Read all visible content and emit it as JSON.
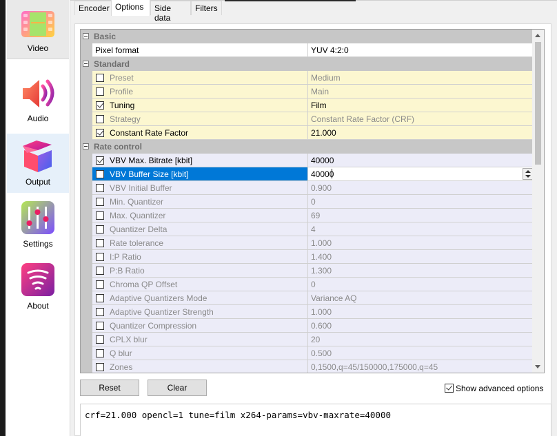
{
  "sidebar": {
    "items": [
      {
        "label": "Video",
        "icon": "video-film-icon"
      },
      {
        "label": "Audio",
        "icon": "speaker-icon"
      },
      {
        "label": "Output",
        "icon": "box-icon"
      },
      {
        "label": "Settings",
        "icon": "sliders-icon"
      },
      {
        "label": "About",
        "icon": "vortex-icon"
      }
    ]
  },
  "tabs": [
    "Encoder",
    "Options",
    "Side data",
    "Filters"
  ],
  "active_tab": "Options",
  "grid": {
    "categories": {
      "basic": "Basic",
      "standard": "Standard",
      "rate_control": "Rate control"
    },
    "pixel_format": {
      "name": "Pixel format",
      "value": "YUV 4:2:0"
    },
    "standard": [
      {
        "name": "Preset",
        "value": "Medium",
        "checked": false
      },
      {
        "name": "Profile",
        "value": "Main",
        "checked": false
      },
      {
        "name": "Tuning",
        "value": "Film",
        "checked": true
      },
      {
        "name": "Strategy",
        "value": "Constant Rate Factor (CRF)",
        "checked": false
      },
      {
        "name": "Constant Rate Factor",
        "value": "21.000",
        "checked": true
      }
    ],
    "rate_control": [
      {
        "name": "VBV Max. Bitrate [kbit]",
        "value": "40000",
        "checked": true
      },
      {
        "name": "VBV Buffer Size [kbit]",
        "value": "40000",
        "checked": false,
        "selected": true
      },
      {
        "name": "VBV Initial Buffer",
        "value": "0.900",
        "checked": false
      },
      {
        "name": "Min. Quantizer",
        "value": "0",
        "checked": false
      },
      {
        "name": "Max. Quantizer",
        "value": "69",
        "checked": false
      },
      {
        "name": "Quantizer Delta",
        "value": "4",
        "checked": false
      },
      {
        "name": "Rate tolerance",
        "value": "1.000",
        "checked": false
      },
      {
        "name": "I:P Ratio",
        "value": "1.400",
        "checked": false
      },
      {
        "name": "P:B Ratio",
        "value": "1.300",
        "checked": false
      },
      {
        "name": "Chroma QP Offset",
        "value": "0",
        "checked": false
      },
      {
        "name": "Adaptive Quantizers Mode",
        "value": "Variance AQ",
        "checked": false
      },
      {
        "name": "Adaptive Quantizer Strength",
        "value": "1.000",
        "checked": false
      },
      {
        "name": "Quantizer Compression",
        "value": "0.600",
        "checked": false
      },
      {
        "name": "CPLX blur",
        "value": "20",
        "checked": false
      },
      {
        "name": "Q blur",
        "value": "0.500",
        "checked": false
      },
      {
        "name": "Zones",
        "value": "0,1500,q=45/150000,175000,q=45",
        "checked": false
      }
    ]
  },
  "buttons": {
    "reset": "Reset",
    "clear": "Clear"
  },
  "advanced": {
    "label": "Show advanced options",
    "checked": true
  },
  "command_line": "crf=21.000 opencl=1 tune=film x264-params=vbv-maxrate=40000",
  "colors": {
    "selection": "#0078d7",
    "standard_row_bg": "#fcf7d0",
    "rate_row_bg": "#ececf8",
    "category_bg": "#c7c7c7"
  }
}
